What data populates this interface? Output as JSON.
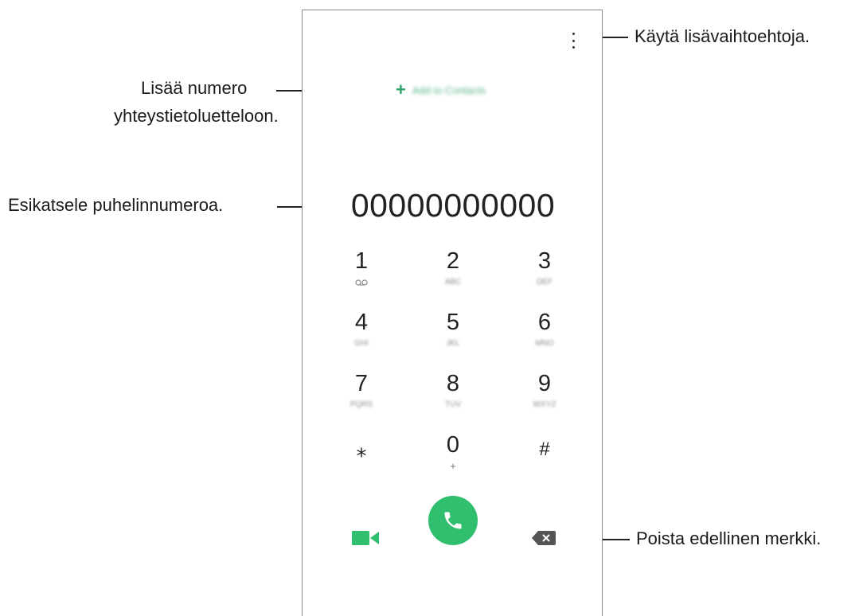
{
  "callouts": {
    "more_options": "Käytä lisävaihtoehtoja.",
    "add_to_contacts_line1": "Lisää numero",
    "add_to_contacts_line2": "yhteystietoluetteloon.",
    "preview_number": "Esikatsele puhelinnumeroa.",
    "delete_char": "Poista edellinen merkki."
  },
  "dialer": {
    "add_to_contacts_label": "Add to Contacts",
    "entered_number": "00000000000",
    "keys": [
      {
        "digit": "1",
        "letters": "",
        "icon": "voicemail-icon"
      },
      {
        "digit": "2",
        "letters": "ABC"
      },
      {
        "digit": "3",
        "letters": "DEF"
      },
      {
        "digit": "4",
        "letters": "GHI"
      },
      {
        "digit": "5",
        "letters": "JKL"
      },
      {
        "digit": "6",
        "letters": "MNO"
      },
      {
        "digit": "7",
        "letters": "PQRS"
      },
      {
        "digit": "8",
        "letters": "TUV"
      },
      {
        "digit": "9",
        "letters": "WXYZ"
      },
      {
        "digit": "⁎",
        "letters": ""
      },
      {
        "digit": "0",
        "letters": "+"
      },
      {
        "digit": "#",
        "letters": ""
      }
    ]
  },
  "icons": {
    "more_options": "more-options-icon",
    "video_call": "video-call-icon",
    "voice_call": "phone-icon",
    "backspace": "backspace-icon"
  },
  "colors": {
    "accent_green": "#2fbf6f",
    "add_contacts_green": "#2fa36b"
  }
}
